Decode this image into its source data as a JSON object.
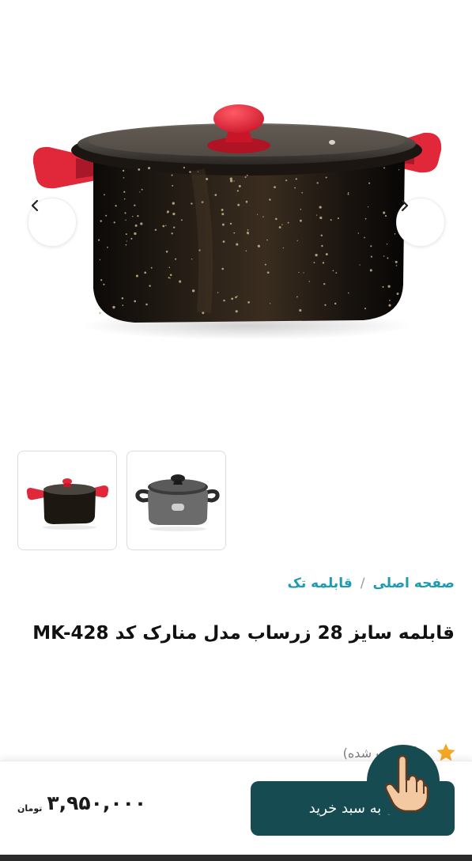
{
  "gallery": {
    "prev_icon": "chevron-left-icon",
    "next_icon": "chevron-right-icon",
    "thumbnails": [
      "black-granite-pot-red-handles",
      "gray-pot-black-handles"
    ]
  },
  "breadcrumb": {
    "home": "صفحه اصلی",
    "separator": "/",
    "category": "قابلمه تک"
  },
  "product": {
    "title": "قابلمه سایز 28 زرساب مدل منارک کد MK-428",
    "rating_text": "ردگاه ثبت شده)",
    "rating_icon": "star-icon"
  },
  "buy_bar": {
    "button_label": "ن به سبد خرید",
    "price": "۳,۹۵۰,۰۰۰",
    "currency": "تومان"
  },
  "colors": {
    "accent": "#1e9bb0",
    "button": "#164b52",
    "star": "#f5a623",
    "pot_red": "#e0283a"
  }
}
